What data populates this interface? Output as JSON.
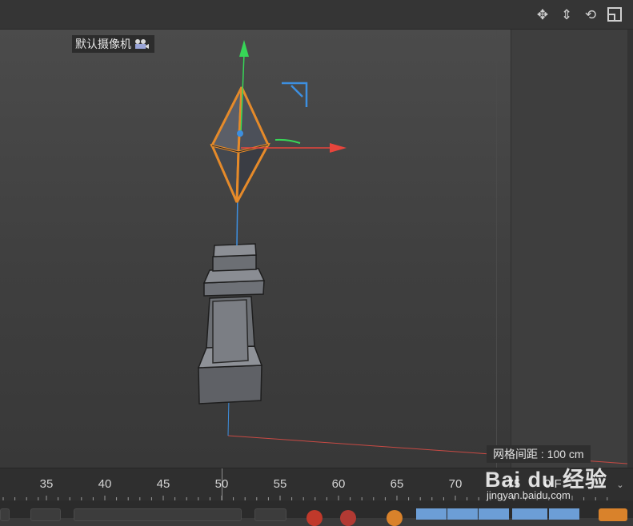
{
  "viewport": {
    "camera_label": "默认摄像机",
    "grid_spacing_label": "网格间距 : 100 cm"
  },
  "nav_icons": [
    "move-view-icon",
    "dolly-view-icon",
    "rotate-view-icon",
    "toggle-view-icon"
  ],
  "timeline": {
    "ticks": [
      "35",
      "40",
      "45",
      "50",
      "55",
      "60",
      "65",
      "70",
      "75"
    ],
    "frame_readout": "0 F"
  },
  "watermark": {
    "main": "Bai du 经验",
    "sub": "jingyan.baidu.com"
  },
  "colors": {
    "x_axis": "#e8453c",
    "y_axis": "#37d657",
    "z_axis": "#3d8fe0",
    "selection": "#e58a2a",
    "toolbar_accent": "#6c9ed6"
  }
}
